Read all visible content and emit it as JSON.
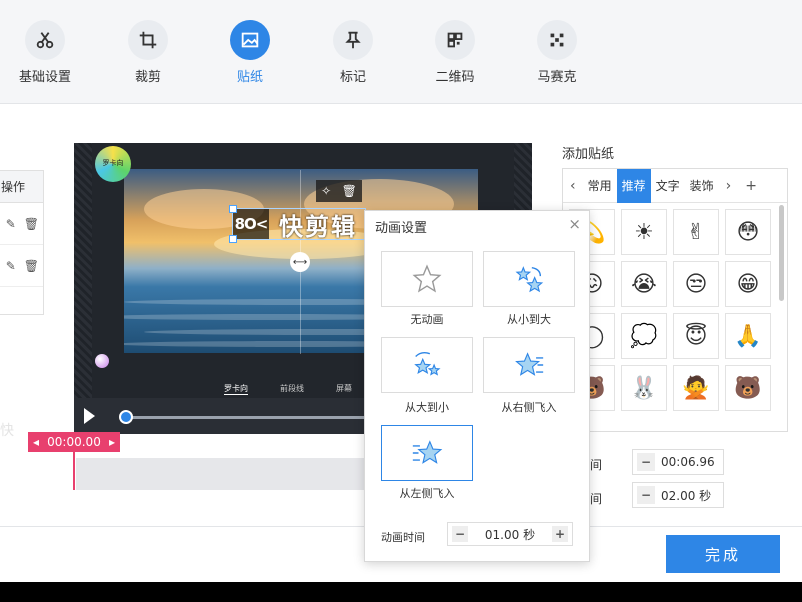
{
  "toolbar": {
    "items": [
      {
        "label": "基础设置",
        "icon": "scissors-icon"
      },
      {
        "label": "裁剪",
        "icon": "crop-icon"
      },
      {
        "label": "贴纸",
        "icon": "image-icon",
        "active": true
      },
      {
        "label": "标记",
        "icon": "pin-icon"
      },
      {
        "label": "二维码",
        "icon": "qrcode-icon"
      },
      {
        "label": "马赛克",
        "icon": "mosaic-icon"
      }
    ],
    "accent": "#2e86e6"
  },
  "left_panel": {
    "header": "操作"
  },
  "video": {
    "badge_text": "罗卡向",
    "sticker_logo": "8O<",
    "sticker_text": "快剪辑",
    "labels": [
      "罗卡向",
      "前段线",
      "屏幕"
    ]
  },
  "timeline": {
    "current_time": "00:00.00"
  },
  "watermark": "快",
  "sticker_panel": {
    "title": "添加贴纸",
    "tabs": [
      "常用",
      "推荐",
      "文字",
      "装饰"
    ],
    "active_tab": "推荐",
    "add_symbol": "+"
  },
  "fields": {
    "start_label": "时间",
    "start_value": "00:06.96",
    "duration_label": "时间",
    "duration_value": "02.00 秒"
  },
  "animation_dialog": {
    "title": "动画设置",
    "options": [
      "无动画",
      "从小到大",
      "从大到小",
      "从右侧飞入",
      "从左侧飞入"
    ],
    "selected": "从左侧飞入",
    "duration_label": "动画时间",
    "duration_value": "01.00 秒"
  },
  "done_button": "完成"
}
